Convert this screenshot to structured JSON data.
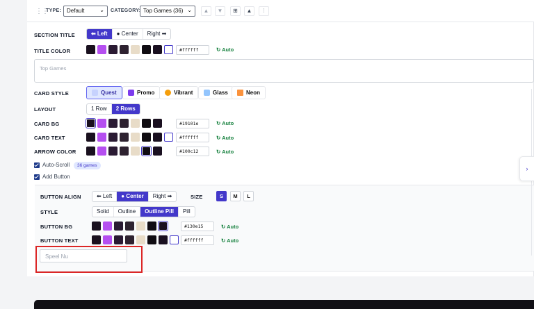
{
  "toolbar": {
    "type_label": "TYPE:",
    "type_value": "Default",
    "category_label": "CATEGORY:",
    "category_value": "Top Games (36)"
  },
  "section_title": {
    "label": "SECTION TITLE",
    "options": [
      "⬅ Left",
      "● Center",
      "Right ➡"
    ],
    "selected": "⬅ Left"
  },
  "title_color": {
    "label": "TITLE COLOR",
    "hex": "#ffffff",
    "auto": "↻ Auto"
  },
  "title_textarea": {
    "placeholder": "Top Games"
  },
  "card_style": {
    "label": "CARD STYLE",
    "options": [
      "Quest",
      "Promo",
      "Vibrant",
      "Glass",
      "Neon"
    ],
    "selected": "Quest"
  },
  "layout": {
    "label": "LAYOUT",
    "options": [
      "1 Row",
      "2 Rows"
    ],
    "selected": "2 Rows"
  },
  "card_bg": {
    "label": "CARD BG",
    "hex": "#19101e",
    "auto": "↻ Auto"
  },
  "card_text": {
    "label": "CARD TEXT",
    "hex": "#ffffff",
    "auto": "↻ Auto"
  },
  "arrow_color": {
    "label": "ARROW COLOR",
    "hex": "#100c12",
    "auto": "↻ Auto"
  },
  "auto_scroll": {
    "label": "Auto-Scroll",
    "badge": "36 games"
  },
  "add_button": {
    "label": "Add Button"
  },
  "button_align": {
    "label": "BUTTON ALIGN",
    "options": [
      "⬅ Left",
      "● Center",
      "Right ➡"
    ],
    "selected": "● Center"
  },
  "size": {
    "label": "SIZE",
    "options": [
      "S",
      "M",
      "L"
    ],
    "selected": "S"
  },
  "style": {
    "label": "STYLE",
    "options": [
      "Solid",
      "Outline",
      "Outline Pill",
      "Pill"
    ],
    "selected": "Outline Pill"
  },
  "button_bg": {
    "label": "BUTTON BG",
    "hex": "#130e15",
    "auto": "↻ Auto"
  },
  "button_text": {
    "label": "BUTTON TEXT",
    "hex": "#ffffff",
    "auto": "↻ Auto"
  },
  "button_label_input": {
    "placeholder": "Speel Nu"
  },
  "side_tab": {
    "glyph": "›"
  },
  "swatch_colors": [
    "#19101e",
    "#b54ff0",
    "#2a1a33",
    "#2e2230",
    "#e8dcc8",
    "#100c12",
    "#1a1020"
  ]
}
